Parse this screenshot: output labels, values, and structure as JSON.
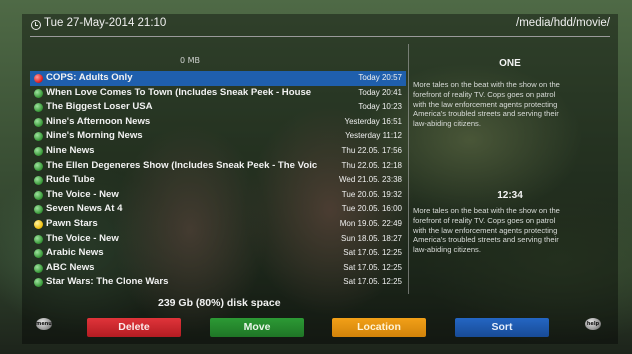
{
  "header": {
    "datetime": "Tue 27-May-2014 21:10",
    "path": "/media/hdd/movie/"
  },
  "free_space": "0 MB",
  "recordings": [
    {
      "title": "COPS: Adults Only",
      "date": "Today 20:57",
      "status": "red",
      "selected": true
    },
    {
      "title": "When Love Comes To Town (Includes Sneak Peek - House",
      "date": "Today 20:41",
      "status": "green"
    },
    {
      "title": "The Biggest Loser USA",
      "date": "Today 10:23",
      "status": "green"
    },
    {
      "title": "Nine's Afternoon News",
      "date": "Yesterday 16:51",
      "status": "green"
    },
    {
      "title": "Nine's Morning News",
      "date": "Yesterday 11:12",
      "status": "green"
    },
    {
      "title": "Nine News",
      "date": "Thu 22.05. 17:56",
      "status": "green"
    },
    {
      "title": "The Ellen Degeneres Show (Includes Sneak Peek - The Voiс",
      "date": "Thu 22.05. 12:18",
      "status": "green"
    },
    {
      "title": "Rude Tube",
      "date": "Wed 21.05. 23:38",
      "status": "green"
    },
    {
      "title": "The Voice - New",
      "date": "Tue 20.05. 19:32",
      "status": "green"
    },
    {
      "title": "Seven News At 4",
      "date": "Tue 20.05. 16:00",
      "status": "green"
    },
    {
      "title": "Pawn Stars",
      "date": "Mon 19.05. 22:49",
      "status": "yellow"
    },
    {
      "title": "The Voice - New",
      "date": "Sun 18.05. 18:27",
      "status": "green"
    },
    {
      "title": "Arabic News",
      "date": "Sat 17.05. 12:25",
      "status": "green"
    },
    {
      "title": "ABC News",
      "date": "Sat 17.05. 12:25",
      "status": "green"
    },
    {
      "title": "Star Wars: The Clone Wars",
      "date": "Sat 17.05. 12:25",
      "status": "green"
    }
  ],
  "disk_space": "239 Gb (80%) disk space",
  "info": {
    "channel": "ONE",
    "description_top": "More tales on the beat with the show on the forefront of reality TV. Cops goes on patrol with the law enforcement agents protecting America's troubled streets and serving their law-abiding citizens.",
    "time": "12:34",
    "description_bottom": "More tales on the beat with the show on the forefront of reality TV. Cops goes on patrol with the law enforcement agents protecting America's troubled streets and serving their law-abiding citizens."
  },
  "buttons": {
    "menu": "menu",
    "delete": "Delete",
    "move": "Move",
    "location": "Location",
    "sort": "Sort",
    "help": "help"
  },
  "colors": {
    "selection": "#1f5fad",
    "red": "#e0343a",
    "green": "#2c9a35",
    "yellow": "#f2a018",
    "blue": "#2466c3"
  }
}
